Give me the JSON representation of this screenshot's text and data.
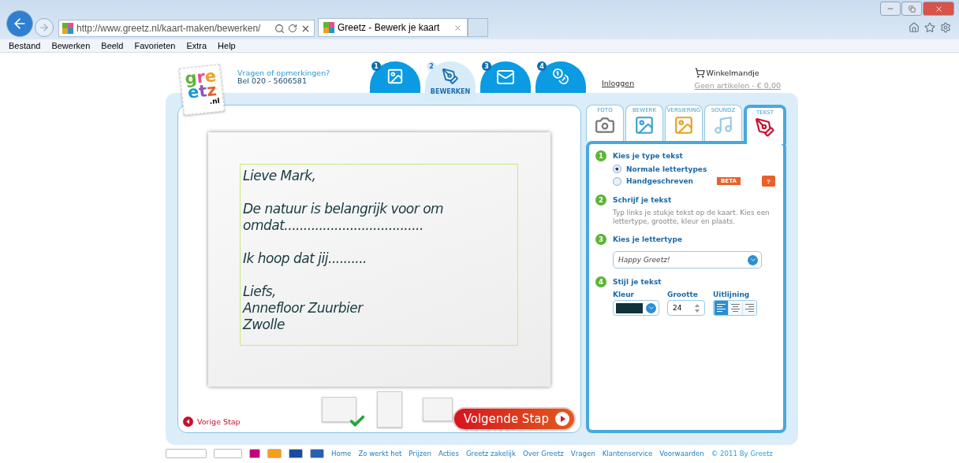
{
  "browser": {
    "address": "http://www.greetz.nl/kaart-maken/bewerken/",
    "tabs": [
      {
        "label": "Greetz - Bewerk je kaart",
        "selected": true
      }
    ],
    "menu": [
      "Bestand",
      "Bewerken",
      "Beeld",
      "Favorieten",
      "Extra",
      "Help"
    ]
  },
  "header": {
    "logo": {
      "lines": [
        "gre",
        "etz"
      ],
      "suffix": ".nl"
    },
    "contact": [
      "Vragen of opmerkingen?",
      "Bel 020 - 5606581"
    ],
    "steps": [
      {
        "number": "1",
        "kind": "photo",
        "selected": false
      },
      {
        "number": "2",
        "kind": "edit",
        "label": "BEWERKEN",
        "selected": true
      },
      {
        "number": "3",
        "kind": "envelope",
        "selected": false
      },
      {
        "number": "4",
        "kind": "pay",
        "selected": false
      }
    ],
    "login": "Inloggen",
    "cart": {
      "title": "Winkelmandje",
      "summary": "Geen artikelen - € 0,00"
    }
  },
  "card": {
    "paragraphs": [
      [
        "Lieve Mark,"
      ],
      [
        "De natuur is belangrijk voor om",
        "omdat...................................."
      ],
      [
        "Ik hoop dat jij.........."
      ],
      [
        "Liefs,",
        "Annefloor Zuurbier",
        "Zwolle"
      ]
    ]
  },
  "views": [
    {
      "kind": "front",
      "selected": true
    },
    {
      "kind": "inside",
      "selected": false
    },
    {
      "kind": "envelope",
      "selected": false
    }
  ],
  "previous": "Vorige Stap",
  "next": "Volgende Stap",
  "tools": {
    "tabs": [
      {
        "label": "FOTO",
        "kind": "camera",
        "selected": false
      },
      {
        "label": "BEWERK",
        "kind": "edit",
        "selected": false
      },
      {
        "label": "VERSIERING",
        "kind": "decor",
        "selected": false
      },
      {
        "label": "SOUNDZ",
        "kind": "music",
        "selected": false
      },
      {
        "label": "TEKST",
        "kind": "text",
        "selected": true
      }
    ],
    "sections": [
      {
        "number": "1",
        "title": "Kies je type tekst",
        "kind": "radios",
        "options": [
          {
            "label": "Normale lettertypes",
            "selected": true
          },
          {
            "label": "Handgeschreven",
            "selected": false,
            "badge": "BETA"
          }
        ],
        "help": "?"
      },
      {
        "number": "2",
        "title": "Schrijf je tekst",
        "kind": "text",
        "text": "Typ links je stukje tekst op de kaart. Kies een lettertype, grootte, kleur en plaats."
      },
      {
        "number": "3",
        "title": "Kies je lettertype",
        "kind": "select",
        "value": "Happy Greetz!"
      },
      {
        "number": "4",
        "title": "Stijl je tekst",
        "kind": "style",
        "color_label": "Kleur",
        "color": "#10323a",
        "size_label": "Grootte",
        "size": "24",
        "align_label": "Uitlijning",
        "align": [
          {
            "kind": "left",
            "selected": true
          },
          {
            "kind": "center",
            "selected": false
          },
          {
            "kind": "right",
            "selected": false
          }
        ]
      }
    ]
  },
  "footer": {
    "links": [
      "Home",
      "Zo werkt het",
      "Prijzen",
      "Acties",
      "Greetz zakelijk",
      "Over Greetz",
      "Vragen",
      "Klantenservice",
      "Voorwaarden"
    ],
    "copyright": "© 2011 By Greetz"
  }
}
